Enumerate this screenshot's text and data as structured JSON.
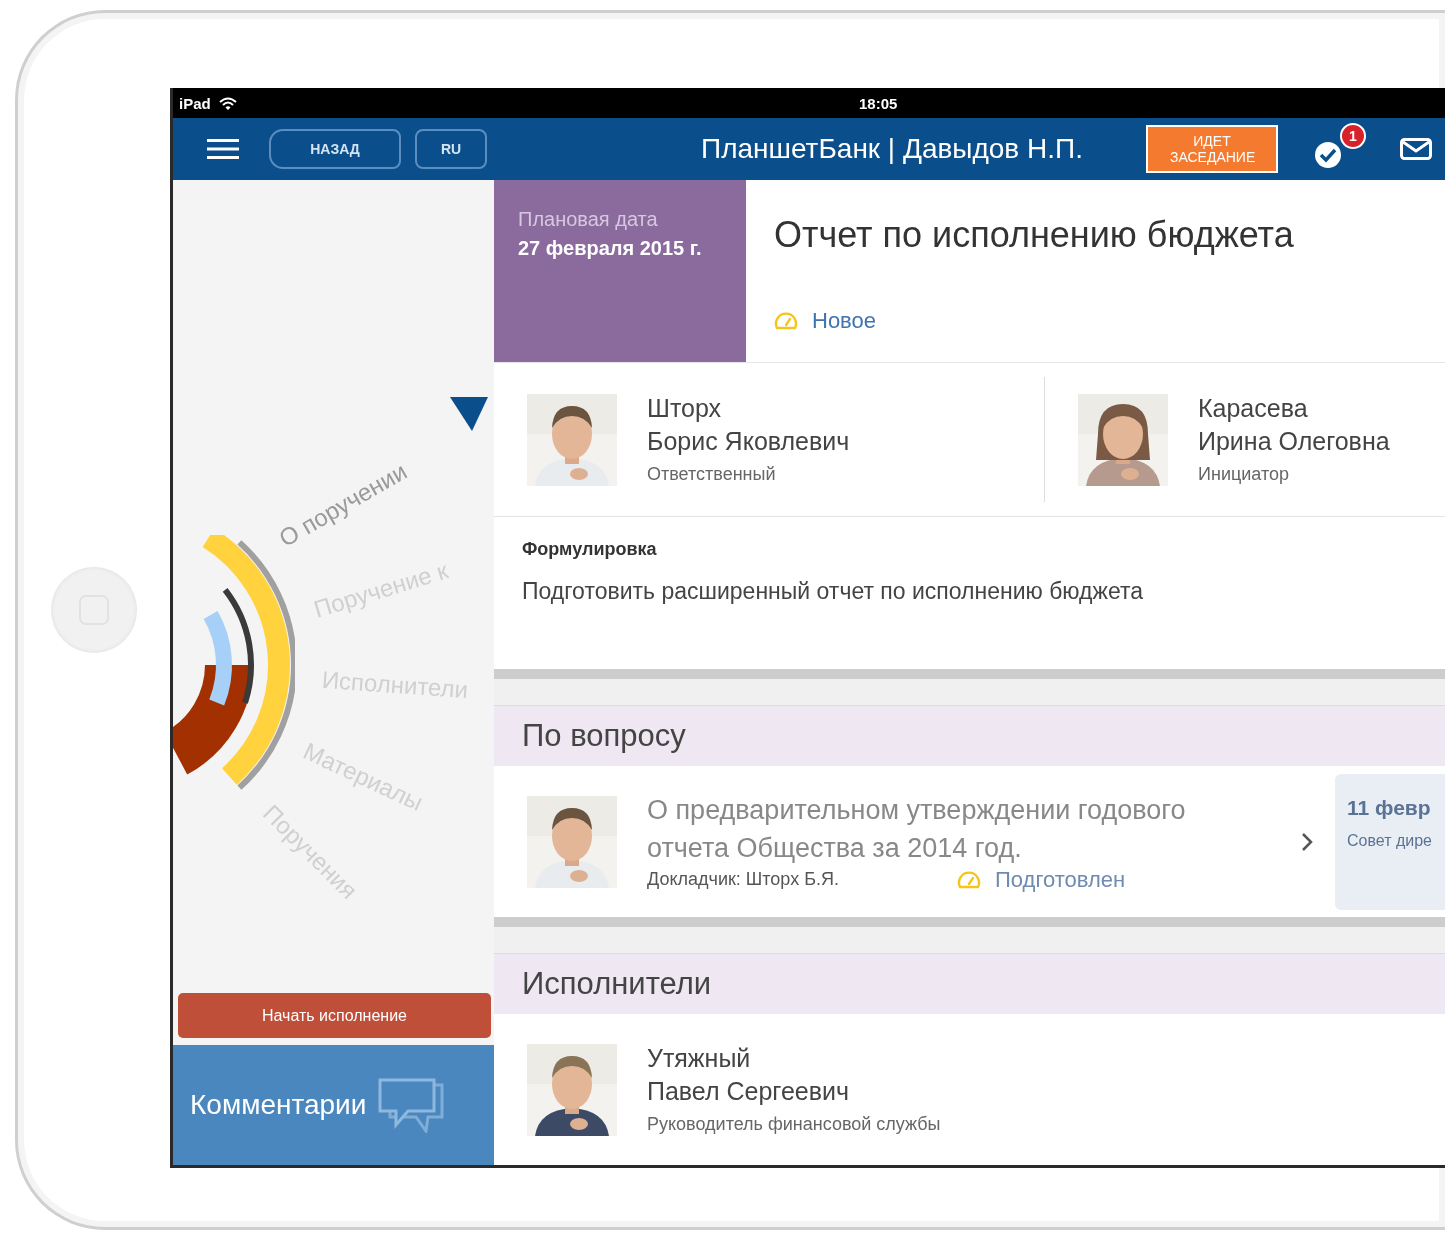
{
  "status_bar": {
    "device": "iPad",
    "time": "18:05"
  },
  "nav": {
    "back": "НАЗАД",
    "language": "RU",
    "title": "ПланшетБанк | Давыдов Н.П.",
    "meeting_button": "ИДЕТ ЗАСЕДАНИЕ",
    "tasks_badge": "1"
  },
  "sidebar": {
    "menu": [
      {
        "label": "О поручении",
        "selected": true
      },
      {
        "label": "Поручение к",
        "selected": false
      },
      {
        "label": "Исполнители",
        "selected": false
      },
      {
        "label": "Материалы",
        "selected": false
      },
      {
        "label": "Поручения",
        "selected": false
      }
    ],
    "start_button": "Начать исполнение",
    "comments": "Комментарии"
  },
  "task": {
    "date_label": "Плановая дата",
    "date": "27 февраля 2015 г.",
    "title": "Отчет по исполнению бюджета",
    "status": "Новое"
  },
  "people": [
    {
      "surname": "Шторх",
      "name": "Борис Яковлевич",
      "role": "Ответственный"
    },
    {
      "surname": "Карасева",
      "name": "Ирина Олеговна",
      "role": "Инициатор"
    }
  ],
  "wording": {
    "label": "Формулировка",
    "text": "Подготовить расширенный отчет по исполнению бюджета"
  },
  "issue": {
    "heading": "По вопросу",
    "title": "О предварительном утверждении годового отчета Общества за 2014 год.",
    "reporter": "Докладчик: Шторх Б.Я.",
    "status": "Подготовлен",
    "date": "11 февр",
    "body": "Совет дире"
  },
  "executors": {
    "heading": "Исполнители",
    "people": [
      {
        "surname": "Утяжный",
        "name": "Павел Сергеевич",
        "role": "Руководитель финансовой службы"
      }
    ]
  }
}
